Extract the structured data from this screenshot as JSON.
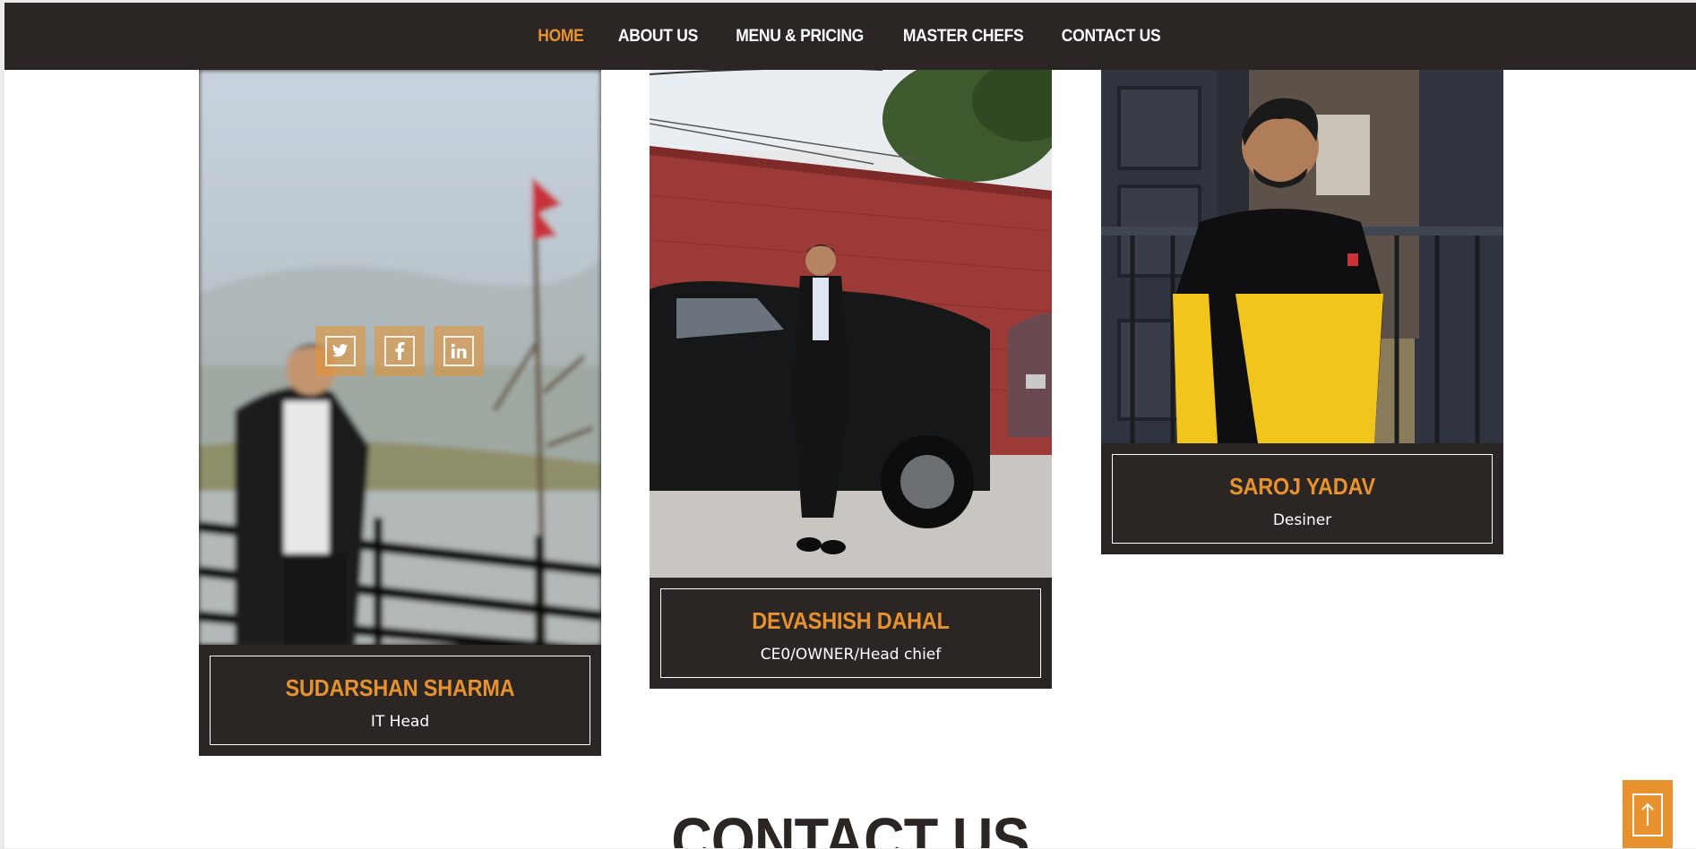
{
  "nav": {
    "items": [
      "HOME",
      "ABOUT US",
      "MENU & PRICING",
      "MASTER CHEFS",
      "CONTACT US"
    ],
    "active": "HOME"
  },
  "team": [
    {
      "name": "SUDARSHAN SHARMA",
      "role": "IT Head"
    },
    {
      "name": "DEVASHISH DAHAL",
      "role": "CE0/OWNER/Head chief"
    },
    {
      "name": "SAROJ YADAV",
      "role": "Desiner"
    }
  ],
  "social_icons": [
    "twitter-icon",
    "facebook-icon",
    "linkedin-icon"
  ],
  "contact": {
    "heading": "CONTACT US"
  },
  "colors": {
    "accent": "#e7922f",
    "dark": "#2b2624",
    "background": "#ffffff"
  }
}
